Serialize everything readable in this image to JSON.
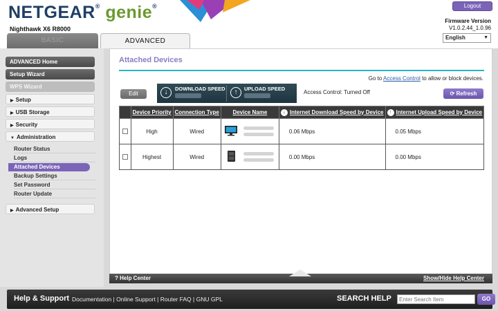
{
  "header": {
    "brand": "NETGEAR",
    "brand_suffix": "genie",
    "model": "Nighthawk X6 R8000",
    "logout_label": "Logout",
    "firmware_label": "Firmware Version",
    "firmware_version": "V1.0.2.44_1.0.96",
    "language": "English"
  },
  "tabs": {
    "basic": "BASIC",
    "advanced": "ADVANCED"
  },
  "sidebar": {
    "advanced_home": "ADVANCED Home",
    "setup_wizard": "Setup Wizard",
    "wps_wizard": "WPS Wizard",
    "setup": "Setup",
    "usb_storage": "USB Storage",
    "security": "Security",
    "administration": "Administration",
    "sub_items": [
      "Router Status",
      "Logs",
      "Attached Devices",
      "Backup Settings",
      "Set Password",
      "Router Update"
    ],
    "advanced_setup": "Advanced Setup"
  },
  "main": {
    "title": "Attached Devices",
    "goto_prefix": "Go to",
    "goto_link": "Access Control",
    "goto_suffix": "to allow or block devices.",
    "edit_label": "Edit",
    "download_speed_label": "DOWNLOAD SPEED",
    "upload_speed_label": "UPLOAD SPEED",
    "access_control_status": "Access Control: Turned Off",
    "refresh_label": "Refresh",
    "table": {
      "headers": [
        "Device Priority",
        "Connection Type",
        "Device Name",
        "Internet Download Speed by Device",
        "Internet Upload Speed by Device"
      ],
      "rows": [
        {
          "priority": "High",
          "connection": "Wired",
          "download": "0.06 Mbps",
          "upload": "0.05 Mbps"
        },
        {
          "priority": "Highest",
          "connection": "Wired",
          "download": "0.00 Mbps",
          "upload": "0.00 Mbps"
        }
      ]
    }
  },
  "help": {
    "help_center": "Help Center",
    "toggle": "Show/Hide Help Center"
  },
  "footer": {
    "title": "Help & Support",
    "links": [
      "Documentation",
      "Online Support",
      "Router FAQ",
      "GNU GPL"
    ],
    "search_label": "SEARCH HELP",
    "search_placeholder": "Enter Search Item",
    "go_label": "GO"
  },
  "colors": {
    "accent": "#7b64b8",
    "brand_blue": "#1e3e66",
    "genie_green": "#6b9a2f",
    "title_line": "#28b2c7"
  }
}
